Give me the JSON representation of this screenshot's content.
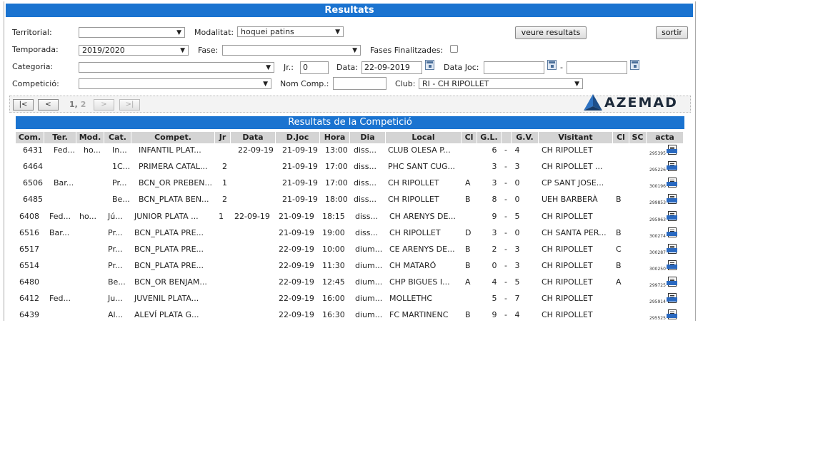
{
  "title": "Resultats",
  "filters": {
    "territorial_label": "Territorial:",
    "territorial_value": "",
    "modalitat_label": "Modalitat:",
    "modalitat_value": "hoquei patins",
    "temporada_label": "Temporada:",
    "temporada_value": "2019/2020",
    "fase_label": "Fase:",
    "fase_value": "",
    "fases_finalitzades_label": "Fases Finalitzades:",
    "categoria_label": "Categoria:",
    "categoria_value": "",
    "jr_label": "Jr.:",
    "jr_value": "0",
    "data_label": "Data:",
    "data_value": "22-09-2019",
    "data_joc_label": "Data Joc:",
    "data_joc_from": "",
    "data_joc_sep": "-",
    "data_joc_to": "",
    "competicio_label": "Competició:",
    "competicio_value": "",
    "nom_comp_label": "Nom Comp.:",
    "nom_comp_value": "",
    "club_label": "Club:",
    "club_value": "RI - CH RIPOLLET"
  },
  "buttons": {
    "veure_resultats": "veure resultats",
    "sortir": "sortir"
  },
  "pager": {
    "first": "|<",
    "prev": "<",
    "next": ">",
    "last": ">|",
    "current_page": "1",
    "sep": ",",
    "other_page": "2"
  },
  "logo_text": "AZEMAD",
  "subtitle": "Resultats de la Competició",
  "columns": [
    "Com.",
    "Ter.",
    "Mod.",
    "Cat.",
    "Compet.",
    "Jr",
    "Data",
    "D.Joc",
    "Hora",
    "Dia",
    "Local",
    "Cl",
    "G.L.",
    "",
    "G.V.",
    "Visitant",
    "Cl",
    "SC",
    "acta"
  ],
  "rows": [
    {
      "com": "6431",
      "ter": "Fed...",
      "mod": "ho...",
      "cat": "In...",
      "compet": "INFANTIL PLAT...",
      "jr": "",
      "data": "22-09-19",
      "djoc": "21-09-19",
      "hora": "13:00",
      "dia": "diss...",
      "local": "CLUB OLESA P...",
      "cl": "",
      "gl": "6",
      "gv": "4",
      "visitant": "CH RIPOLLET",
      "cl2": "",
      "sc": "",
      "acta": "295395"
    },
    {
      "com": "6464",
      "ter": "",
      "mod": "",
      "cat": "1C...",
      "compet": "PRIMERA CATAL...",
      "jr": "2",
      "data": "",
      "djoc": "21-09-19",
      "hora": "17:00",
      "dia": "diss...",
      "local": "PHC SANT CUG...",
      "cl": "",
      "gl": "3",
      "gv": "3",
      "visitant": "CH RIPOLLET ...",
      "cl2": "",
      "sc": "",
      "acta": "295226"
    },
    {
      "com": "6506",
      "ter": "Bar...",
      "mod": "",
      "cat": "Pr...",
      "compet": "BCN_OR PREBEN...",
      "jr": "1",
      "data": "",
      "djoc": "21-09-19",
      "hora": "17:00",
      "dia": "diss...",
      "local": "CH RIPOLLET",
      "cl": "A",
      "gl": "3",
      "gv": "0",
      "visitant": "CP SANT JOSE...",
      "cl2": "",
      "sc": "",
      "acta": "300196"
    },
    {
      "com": "6485",
      "ter": "",
      "mod": "",
      "cat": "Be...",
      "compet": "BCN_PLATA BEN...",
      "jr": "2",
      "data": "",
      "djoc": "21-09-19",
      "hora": "18:00",
      "dia": "diss...",
      "local": "CH RIPOLLET",
      "cl": "B",
      "gl": "8",
      "gv": "0",
      "visitant": "UEH BARBERÀ",
      "cl2": "B",
      "sc": "",
      "acta": "299853"
    },
    {
      "com": "6408",
      "ter": "Fed...",
      "mod": "ho...",
      "cat": "Jú...",
      "compet": "JUNIOR PLATA ...",
      "jr": "1",
      "data": "22-09-19",
      "djoc": "21-09-19",
      "hora": "18:15",
      "dia": "diss...",
      "local": "CH ARENYS DE...",
      "cl": "",
      "gl": "9",
      "gv": "5",
      "visitant": "CH RIPOLLET",
      "cl2": "",
      "sc": "",
      "acta": "295963"
    },
    {
      "com": "6516",
      "ter": "Bar...",
      "mod": "",
      "cat": "Pr...",
      "compet": "BCN_PLATA PRE...",
      "jr": "",
      "data": "",
      "djoc": "21-09-19",
      "hora": "19:00",
      "dia": "diss...",
      "local": "CH RIPOLLET",
      "cl": "D",
      "gl": "3",
      "gv": "0",
      "visitant": "CH SANTA PER...",
      "cl2": "B",
      "sc": "",
      "acta": "300274"
    },
    {
      "com": "6517",
      "ter": "",
      "mod": "",
      "cat": "Pr...",
      "compet": "BCN_PLATA PRE...",
      "jr": "",
      "data": "",
      "djoc": "22-09-19",
      "hora": "10:00",
      "dia": "dium...",
      "local": "CE ARENYS DE...",
      "cl": "B",
      "gl": "2",
      "gv": "3",
      "visitant": "CH RIPOLLET",
      "cl2": "C",
      "sc": "",
      "acta": "300287"
    },
    {
      "com": "6514",
      "ter": "",
      "mod": "",
      "cat": "Pr...",
      "compet": "BCN_PLATA PRE...",
      "jr": "",
      "data": "",
      "djoc": "22-09-19",
      "hora": "11:30",
      "dia": "dium...",
      "local": "CH MATARÓ",
      "cl": "B",
      "gl": "0",
      "gv": "3",
      "visitant": "CH RIPOLLET",
      "cl2": "B",
      "sc": "",
      "acta": "300250"
    },
    {
      "com": "6480",
      "ter": "",
      "mod": "",
      "cat": "Be...",
      "compet": "BCN_OR BENJAM...",
      "jr": "",
      "data": "",
      "djoc": "22-09-19",
      "hora": "12:45",
      "dia": "dium...",
      "local": "CHP BIGUES I...",
      "cl": "A",
      "gl": "4",
      "gv": "5",
      "visitant": "CH RIPOLLET",
      "cl2": "A",
      "sc": "",
      "acta": "299725"
    },
    {
      "com": "6412",
      "ter": "Fed...",
      "mod": "",
      "cat": "Ju...",
      "compet": "JUVENIL PLATA...",
      "jr": "",
      "data": "",
      "djoc": "22-09-19",
      "hora": "16:00",
      "dia": "dium...",
      "local": "MOLLETHC",
      "cl": "",
      "gl": "5",
      "gv": "7",
      "visitant": "CH RIPOLLET",
      "cl2": "",
      "sc": "",
      "acta": "295914"
    },
    {
      "com": "6439",
      "ter": "",
      "mod": "",
      "cat": "Al...",
      "compet": "ALEVÍ PLATA G...",
      "jr": "",
      "data": "",
      "djoc": "22-09-19",
      "hora": "16:30",
      "dia": "dium...",
      "local": "FC MARTINENC",
      "cl": "B",
      "gl": "9",
      "gv": "4",
      "visitant": "CH RIPOLLET",
      "cl2": "",
      "sc": "",
      "acta": "295525"
    }
  ],
  "score_sep": "-",
  "acta_label": "ACTA",
  "colors": {
    "header_blue": "#1a73d0",
    "th_gray": "#d4d4d4"
  }
}
